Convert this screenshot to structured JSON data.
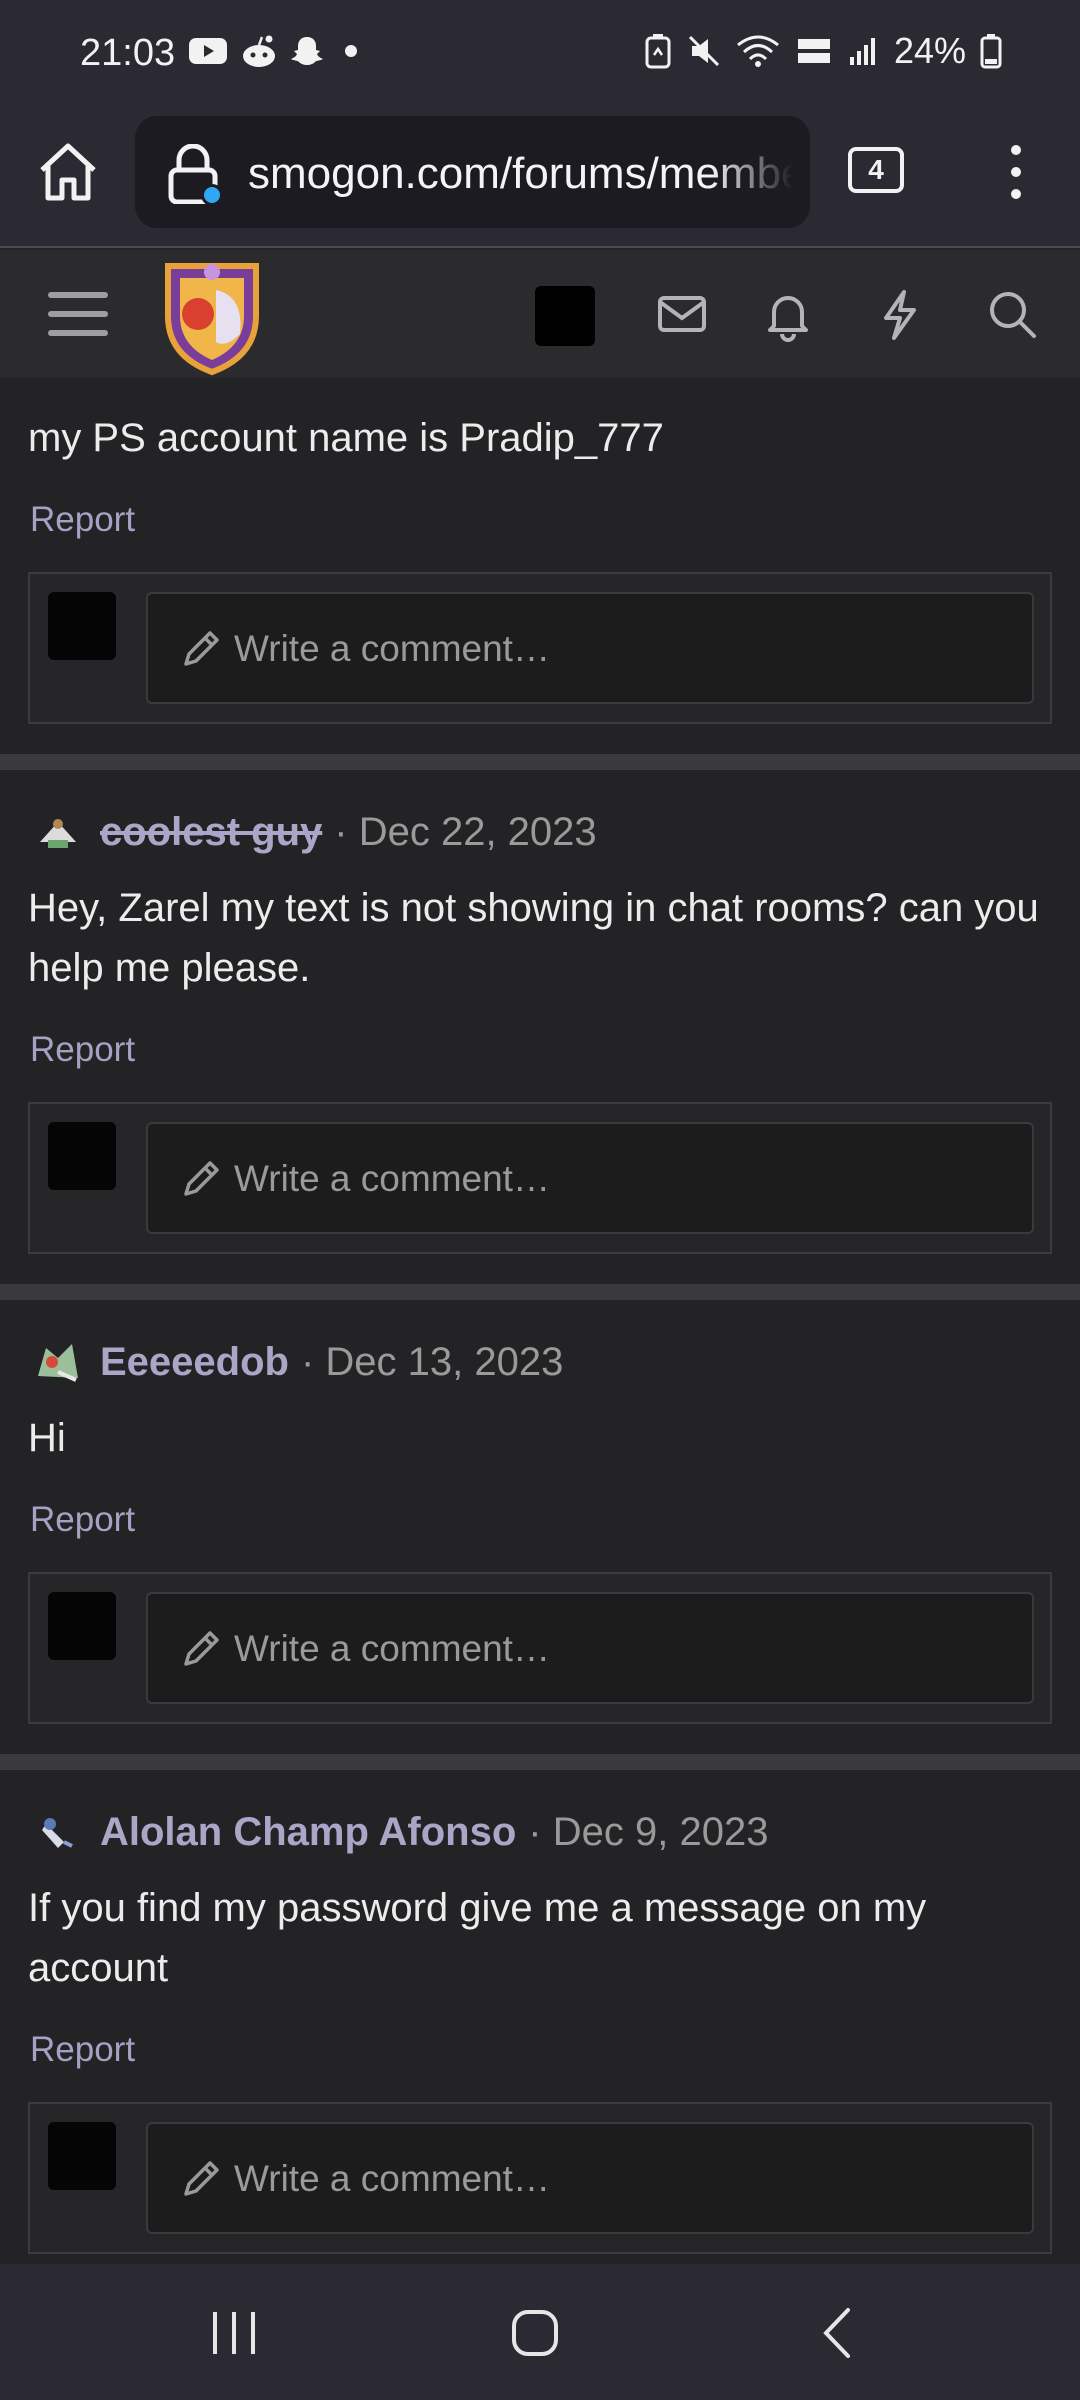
{
  "status_bar": {
    "time": "21:03",
    "battery": "24%",
    "left_icons": [
      "youtube-icon",
      "reddit-icon",
      "snapchat-icon",
      "dot-icon"
    ],
    "right_icons": [
      "battery-saver-icon",
      "mute-icon",
      "wifi-icon",
      "volte-icon",
      "signal-icon",
      "battery-icon"
    ]
  },
  "browser": {
    "url": "smogon.com/forums/members",
    "tab_count": "4"
  },
  "site_header": {
    "icons": [
      "menu-icon",
      "site-logo",
      "account-avatar",
      "mail-icon",
      "bell-icon",
      "bolt-icon",
      "search-icon"
    ]
  },
  "feed": {
    "top_post": {
      "text": "my PS account name is Pradip_777",
      "report": "Report",
      "comment_placeholder": "Write a comment…"
    },
    "posts": [
      {
        "username": "coolest guy",
        "date": "· Dec 22, 2023",
        "text": "Hey, Zarel my text is not showing in chat rooms? can you help me please.",
        "report": "Report",
        "comment_placeholder": "Write a comment…"
      },
      {
        "username": "Eeeeedob",
        "date": "· Dec 13, 2023",
        "text": "Hi",
        "report": "Report",
        "comment_placeholder": "Write a comment…"
      },
      {
        "username": "Alolan Champ Afonso",
        "date": "· Dec 9, 2023",
        "text": "If you find my password give me a message on my account",
        "report": "Report",
        "comment_placeholder": "Write a comment…"
      }
    ]
  },
  "nav_bar": {
    "buttons": [
      "recents-icon",
      "home-icon",
      "back-icon"
    ]
  }
}
